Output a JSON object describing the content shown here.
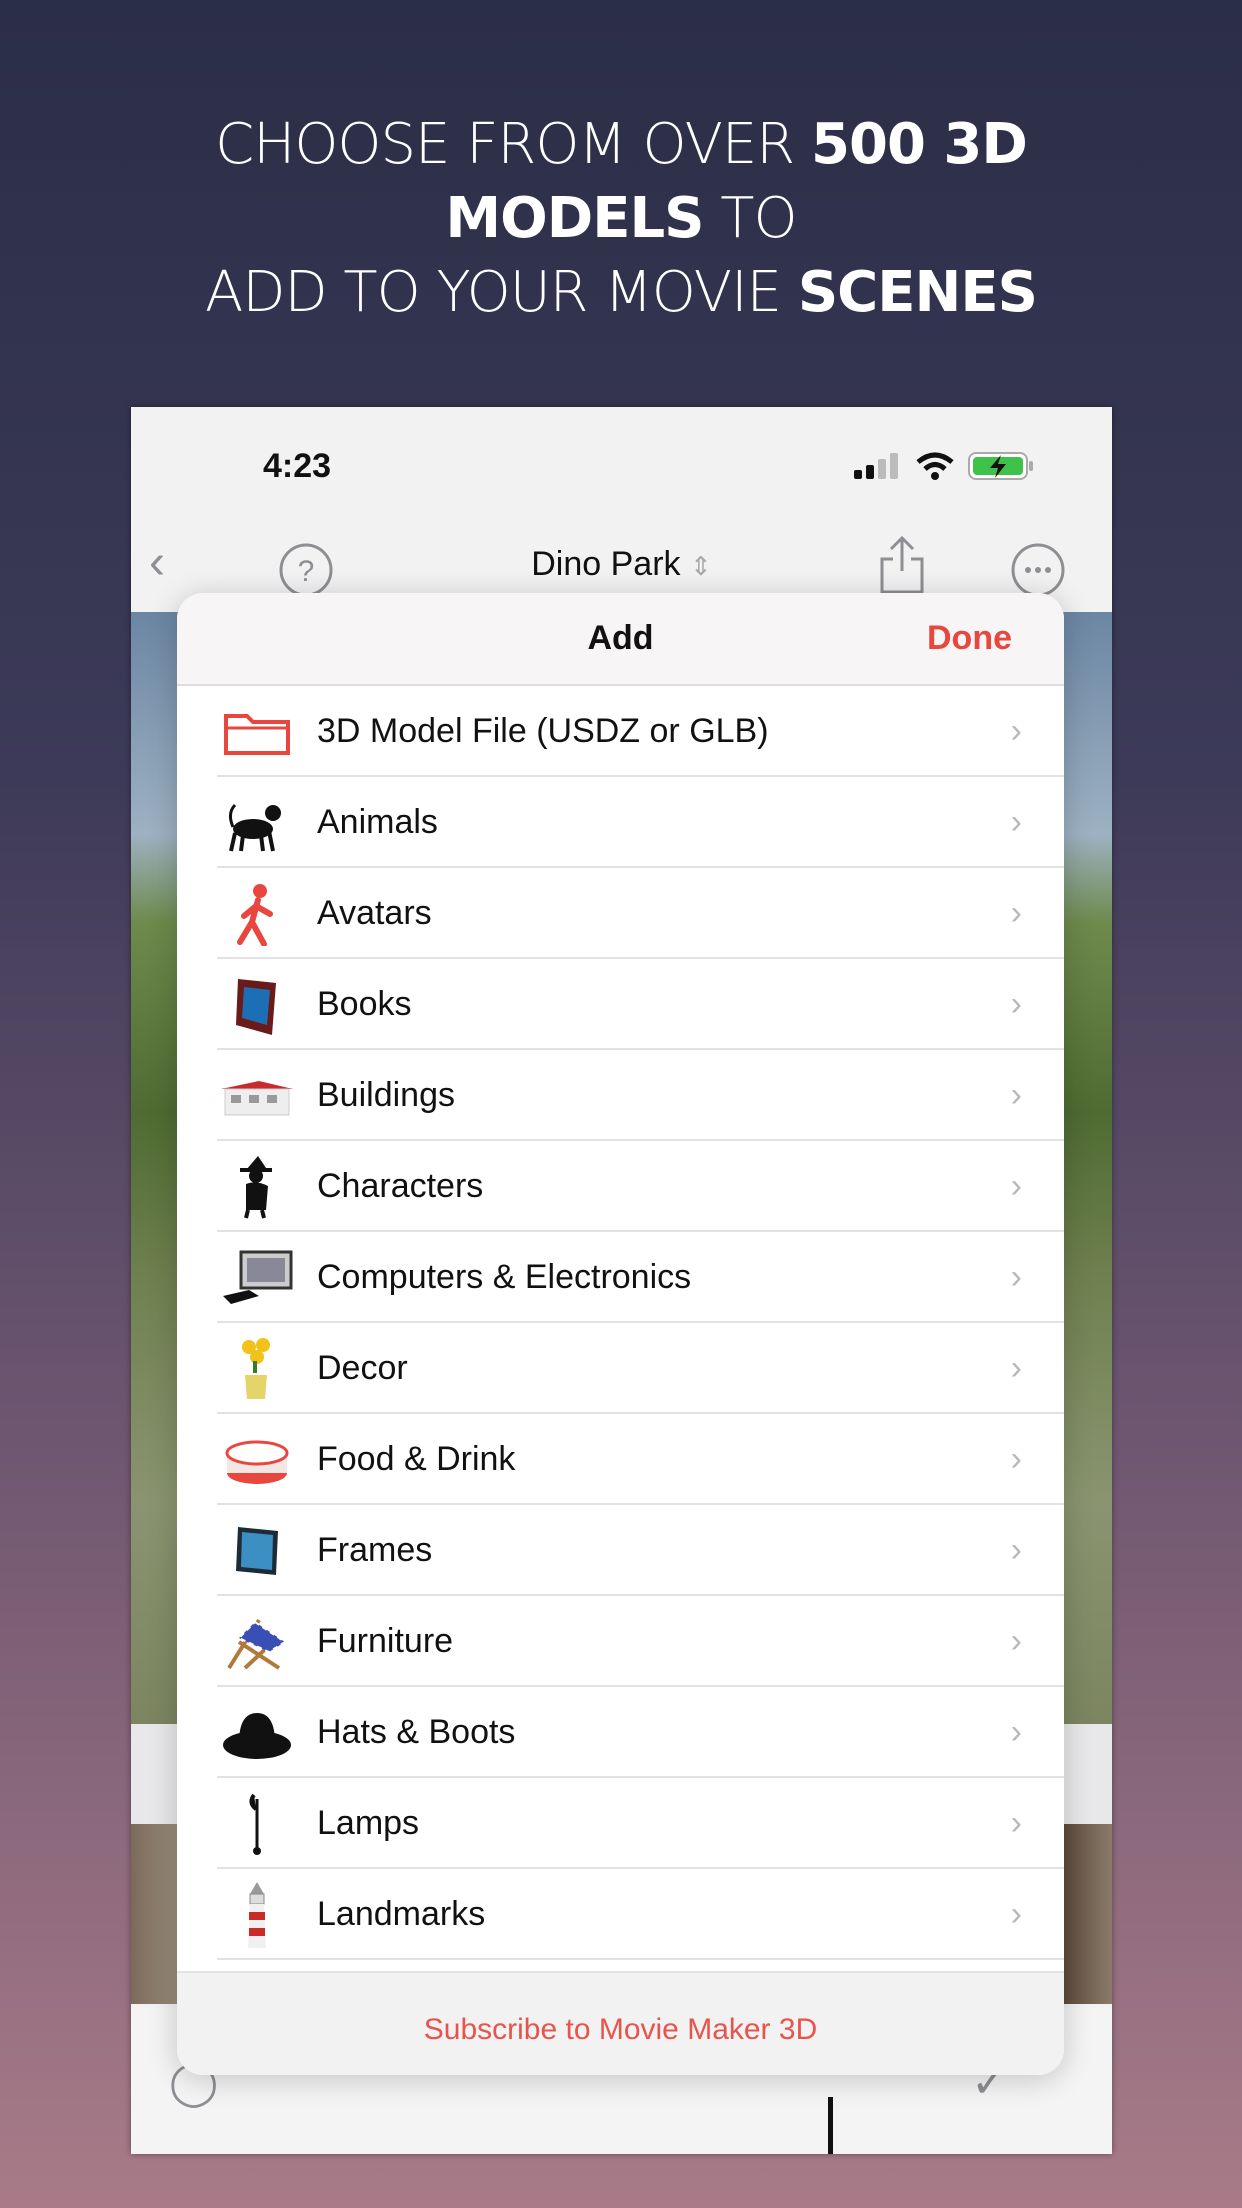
{
  "headline": {
    "line1_normal": "CHOOSE FROM OVER ",
    "line1_bold": "500 3D",
    "line2_bold": "MODELS",
    "line2_normal": " TO",
    "line3_normal": "ADD TO YOUR MOVIE ",
    "line3_bold": "SCENES"
  },
  "status_bar": {
    "time": "4:23",
    "icons": [
      "signal-icon",
      "wifi-icon",
      "battery-charging-icon"
    ],
    "battery_color": "#3ec24a"
  },
  "nav": {
    "title": "Dino Park",
    "icons": [
      "back-chevron-icon",
      "help-icon",
      "sort-chevrons-icon",
      "share-icon",
      "more-icon"
    ]
  },
  "sheet": {
    "title": "Add",
    "done_label": "Done",
    "accent": "#e8473f",
    "items": [
      {
        "label": "3D Model File (USDZ or GLB)",
        "icon": "folder-icon"
      },
      {
        "label": "Animals",
        "icon": "cat-icon"
      },
      {
        "label": "Avatars",
        "icon": "walking-person-icon"
      },
      {
        "label": "Books",
        "icon": "book-icon"
      },
      {
        "label": "Buildings",
        "icon": "building-icon"
      },
      {
        "label": "Characters",
        "icon": "witch-icon"
      },
      {
        "label": "Computers & Electronics",
        "icon": "computer-icon"
      },
      {
        "label": "Decor",
        "icon": "flower-vase-icon"
      },
      {
        "label": "Food & Drink",
        "icon": "cake-icon"
      },
      {
        "label": "Frames",
        "icon": "frame-icon"
      },
      {
        "label": "Furniture",
        "icon": "deck-chair-icon"
      },
      {
        "label": "Hats & Boots",
        "icon": "hat-icon"
      },
      {
        "label": "Lamps",
        "icon": "lamp-icon"
      },
      {
        "label": "Landmarks",
        "icon": "lighthouse-icon"
      }
    ],
    "footer_link": "Subscribe to Movie Maker 3D"
  }
}
